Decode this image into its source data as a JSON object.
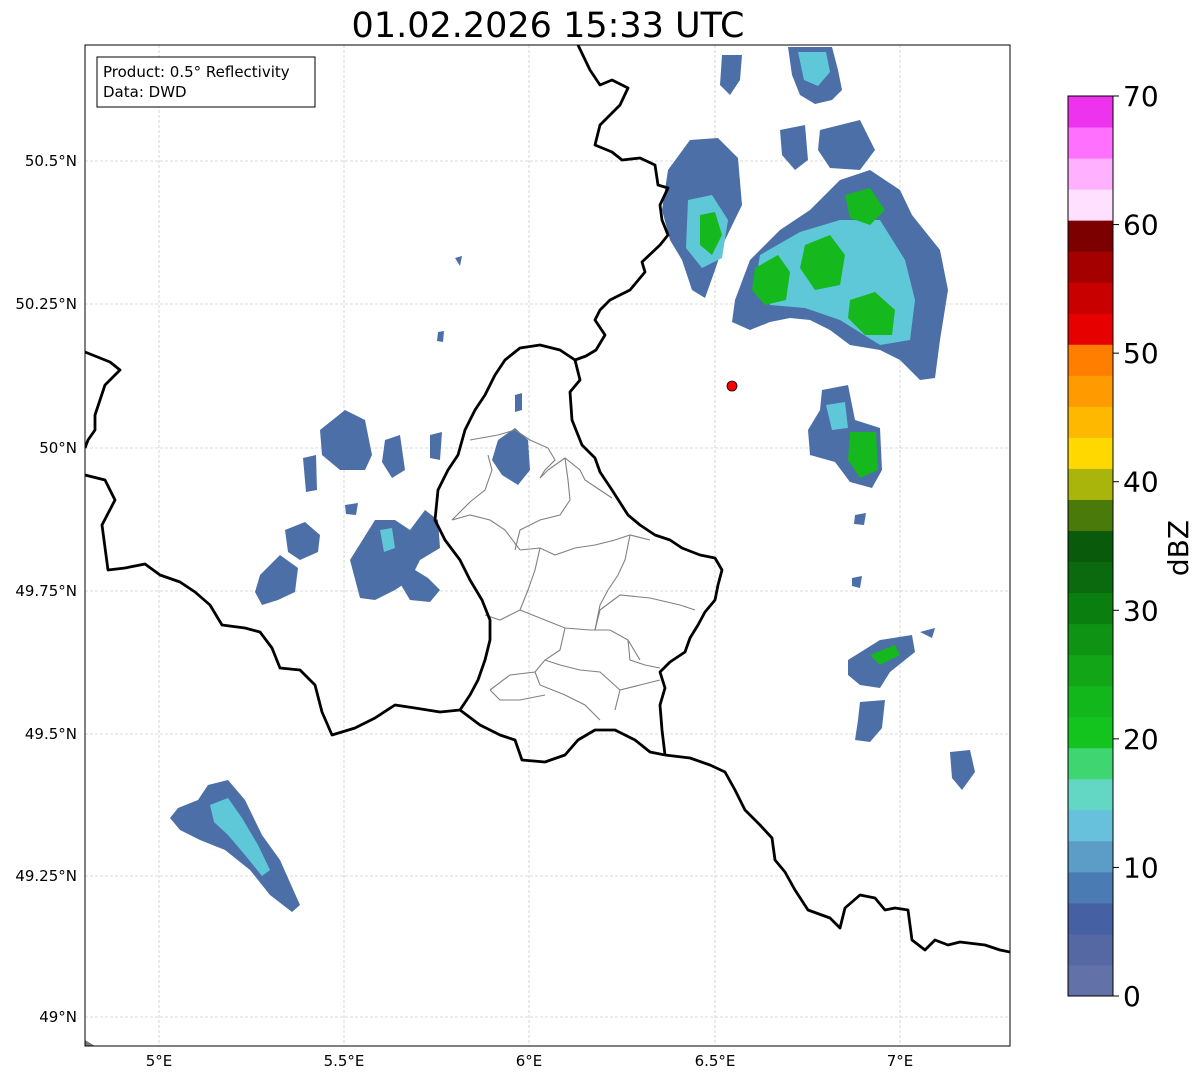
{
  "title": "01.02.2026 15:33 UTC",
  "info_box": {
    "product_line": "Product: 0.5° Reflectivity",
    "data_line": "Data: DWD"
  },
  "axes": {
    "lat_ticks": [
      "50.5°N",
      "50.25°N",
      "50°N",
      "49.75°N",
      "49.5°N",
      "49.25°N",
      "49°N"
    ],
    "lon_ticks": [
      "5°E",
      "5.5°E",
      "6°E",
      "6.5°E",
      "7°E"
    ],
    "lat_values": [
      50.5,
      50.25,
      50.0,
      49.75,
      49.5,
      49.25,
      49.0
    ],
    "lon_values": [
      5.0,
      5.5,
      6.0,
      6.5,
      7.0
    ],
    "lon_range": [
      4.8,
      7.3
    ],
    "lat_range": [
      48.95,
      50.7
    ],
    "grid": true
  },
  "colorbar": {
    "label": "dBZ",
    "range": [
      0,
      70
    ],
    "ticks": [
      "0",
      "10",
      "20",
      "30",
      "40",
      "50",
      "60",
      "70"
    ],
    "colors": [
      "#6272a8",
      "#5568a4",
      "#4660a4",
      "#4b7bb3",
      "#5b9dc7",
      "#67c1dc",
      "#64d6c4",
      "#3fd672",
      "#13c41f",
      "#12b71c",
      "#12a517",
      "#0e9314",
      "#0b7e10",
      "#0a6a0d",
      "#0a5a0b",
      "#4a7a0a",
      "#aab50c",
      "#ffd800",
      "#ffb800",
      "#ff9b00",
      "#ff7e00",
      "#e60000",
      "#c80000",
      "#a50000",
      "#7d0000",
      "#ffe0ff",
      "#ffb0ff",
      "#ff70ff",
      "#ee33ee"
    ],
    "position": "right"
  },
  "marker": {
    "name": "radar-site",
    "color": "#ff0000",
    "lon": 6.547,
    "lat": 50.11
  },
  "colors": {
    "border": "#000000",
    "admin_border": "#808080",
    "grid": "#b0b0b0",
    "weak_echo": "#4c6fa8",
    "mid_echo": "#5fc8d8",
    "green_echo": "#15b81d"
  }
}
